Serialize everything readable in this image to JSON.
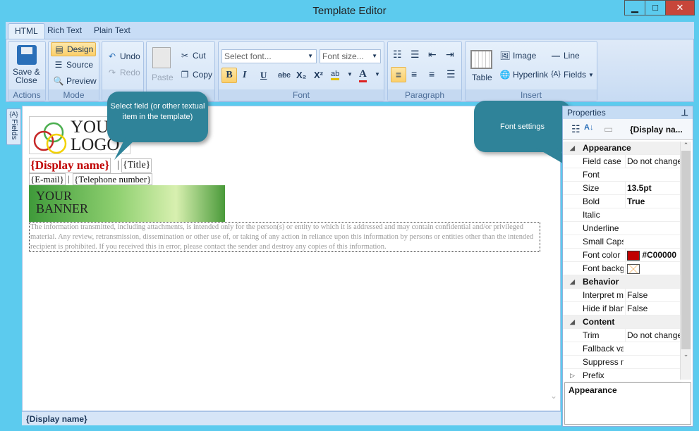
{
  "window": {
    "title": "Template Editor",
    "minimize": "▁",
    "maximize": "□",
    "close": "✕"
  },
  "tabs": [
    {
      "label": "HTML"
    },
    {
      "label": "Rich Text"
    },
    {
      "label": "Plain Text"
    }
  ],
  "ribbon": {
    "actions": {
      "label": "Actions",
      "save_close": "Save &\nClose"
    },
    "mode": {
      "label": "Mode",
      "design": "Design",
      "source": "Source",
      "preview": "Preview"
    },
    "history": {
      "undo": "Undo",
      "redo": "Redo"
    },
    "clipboard": {
      "paste": "Paste",
      "cut": "Cut",
      "copy": "Copy"
    },
    "font": {
      "label": "Font",
      "font_placeholder": "Select font...",
      "size_placeholder": "Font size...",
      "bold": "B",
      "italic": "I",
      "underline": "U",
      "strike": "abc",
      "sub": "X₂",
      "sup": "X²",
      "highlight": "ab",
      "color": "A"
    },
    "paragraph": {
      "label": "Paragraph"
    },
    "insert": {
      "label": "Insert",
      "table": "Table",
      "image": "Image",
      "line": "Line",
      "hyperlink": "Hyperlink",
      "fields": "Fields",
      "fields_icon": "{A}"
    }
  },
  "fields_tab": {
    "icon": "{A}",
    "label": "Fields"
  },
  "template": {
    "logo": {
      "line1": "YOUR",
      "line2": "LOGO"
    },
    "display_name": "{Display name}",
    "sep": "|",
    "title": "{Title}",
    "email": "{E-mail}",
    "telephone": "{Telephone number}",
    "banner": {
      "line1": "YOUR",
      "line2": "BANNER"
    },
    "disclaimer": "The information transmitted, including attachments, is intended only for the person(s) or entity to which it is addressed and may contain confidential and/or privileged material. Any review, retransmission, dissemination or other use of, or taking of any action in reliance upon this information by persons or entities other than the intended recipient is prohibited. If you received this in error, please contact the sender and destroy any copies of this information."
  },
  "callouts": {
    "select_field": "Select field (or other textual item in the template)",
    "font_settings": "Font settings"
  },
  "status": {
    "selected": "{Display name}"
  },
  "properties": {
    "title": "Properties",
    "pin": "ᵖ",
    "object": "{Display na...",
    "rows": [
      {
        "cat": true,
        "name": "Appearance"
      },
      {
        "name": "Field case",
        "value": "Do not change"
      },
      {
        "name": "Font",
        "value": ""
      },
      {
        "name": "Size",
        "value": "13.5pt",
        "bold": true
      },
      {
        "name": "Bold",
        "value": "True",
        "bold": true
      },
      {
        "name": "Italic",
        "value": ""
      },
      {
        "name": "Underline",
        "value": ""
      },
      {
        "name": "Small Caps",
        "value": ""
      },
      {
        "name": "Font color",
        "value": "#C00000",
        "swatch": "#c00000",
        "bold": true
      },
      {
        "name": "Font background",
        "value": "",
        "swatch": "none"
      },
      {
        "cat": true,
        "name": "Behavior"
      },
      {
        "name": "Interpret markup",
        "value": "False"
      },
      {
        "name": "Hide if blank",
        "value": "False"
      },
      {
        "cat": true,
        "name": "Content"
      },
      {
        "name": "Trim",
        "value": "Do not change"
      },
      {
        "name": "Fallback value",
        "value": ""
      },
      {
        "name": "Suppress newlines",
        "value": ""
      },
      {
        "name": "Prefix",
        "value": "",
        "collapsed": true
      }
    ],
    "description": "Appearance"
  },
  "colors": {
    "titlebar": "#5ccbee",
    "accent_red": "#c00000",
    "callout": "#2f8399"
  }
}
